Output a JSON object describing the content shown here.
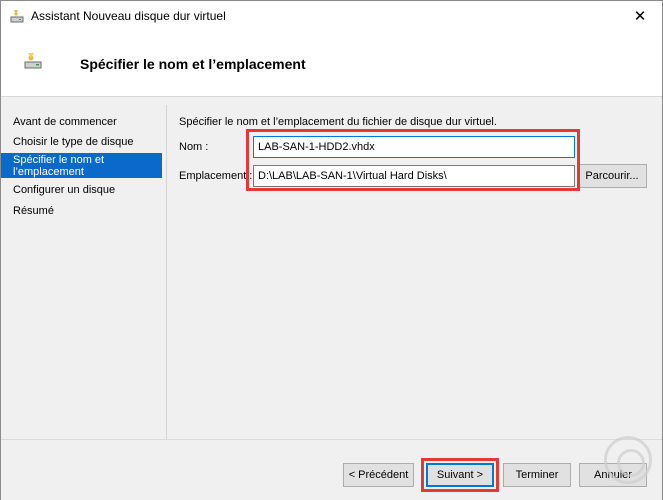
{
  "window": {
    "title": "Assistant Nouveau disque dur virtuel",
    "close_glyph": "✕"
  },
  "header": {
    "title": "Spécifier le nom et l’emplacement",
    "icon": "disk-wizard-icon"
  },
  "sidebar": {
    "items": [
      {
        "label": "Avant de commencer"
      },
      {
        "label": "Choisir le type de disque"
      },
      {
        "label_line1": "Spécifier le nom et",
        "label_line2": "l’emplacement"
      },
      {
        "label": "Configurer un disque"
      },
      {
        "label": "Résumé"
      }
    ]
  },
  "main": {
    "description": "Spécifier le nom et l’emplacement du fichier de disque dur virtuel.",
    "name_label": "Nom :",
    "name_value": "LAB-SAN-1-HDD2.vhdx",
    "location_label": "Emplacement :",
    "location_value": "D:\\LAB\\LAB-SAN-1\\Virtual Hard Disks\\",
    "browse_label": "Parcourir..."
  },
  "footer": {
    "previous_label": "< Précédent",
    "next_label": "Suivant >",
    "finish_label": "Terminer",
    "cancel_label": "Annuler"
  },
  "colors": {
    "selection": "#0b69c9",
    "highlight": "#e53935",
    "focus_border": "#0078d7"
  }
}
